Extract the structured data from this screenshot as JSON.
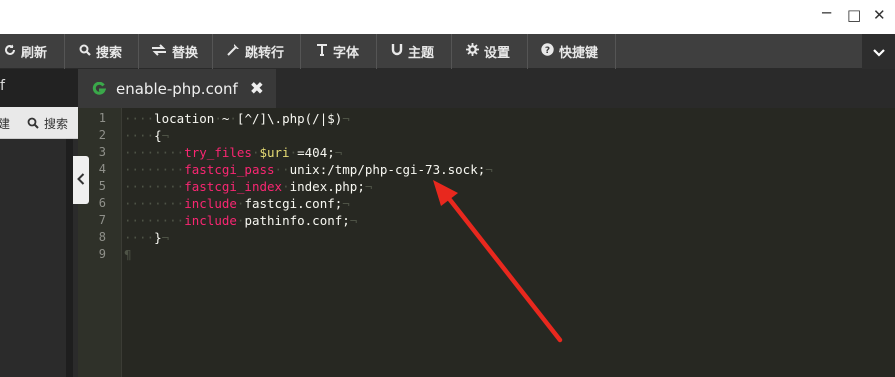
{
  "window": {
    "minimize_glyph": "─",
    "maximize_glyph": "□",
    "close_glyph": "✕"
  },
  "toolbar": {
    "items": [
      {
        "label": "刷新",
        "icon": "refresh-icon"
      },
      {
        "label": "搜索",
        "icon": "search-icon"
      },
      {
        "label": "替换",
        "icon": "replace-icon"
      },
      {
        "label": "跳转行",
        "icon": "goto-line-icon"
      },
      {
        "label": "字体",
        "icon": "font-icon"
      },
      {
        "label": "主题",
        "icon": "theme-icon"
      },
      {
        "label": "设置",
        "icon": "gear-icon"
      },
      {
        "label": "快捷键",
        "icon": "help-icon"
      }
    ],
    "more_icon": "chevron-down-icon"
  },
  "left_panel": {
    "header_fragment": "f",
    "bar_left_fragment": "建",
    "search_label": "搜索"
  },
  "tab": {
    "name": "enable-php.conf",
    "close_glyph": "✖",
    "icon": "file-type-icon"
  },
  "editor": {
    "line_numbers": [
      "1",
      "2",
      "3",
      "4",
      "5",
      "6",
      "7",
      "8",
      "9"
    ],
    "lines": [
      [
        {
          "t": "····",
          "c": "ws"
        },
        {
          "t": "location",
          "c": "op"
        },
        {
          "t": "·",
          "c": "ws"
        },
        {
          "t": "~",
          "c": "op"
        },
        {
          "t": "·",
          "c": "ws"
        },
        {
          "t": "[^/]\\.php(/|$)",
          "c": "op"
        },
        {
          "t": "¬",
          "c": "eol"
        }
      ],
      [
        {
          "t": "····",
          "c": "ws"
        },
        {
          "t": "{",
          "c": "op"
        },
        {
          "t": "¬",
          "c": "eol"
        }
      ],
      [
        {
          "t": "········",
          "c": "ws"
        },
        {
          "t": "try_files",
          "c": "kw"
        },
        {
          "t": "·",
          "c": "ws"
        },
        {
          "t": "$uri",
          "c": "var"
        },
        {
          "t": "·",
          "c": "ws"
        },
        {
          "t": "=404;",
          "c": "op"
        },
        {
          "t": "¬",
          "c": "eol"
        }
      ],
      [
        {
          "t": "········",
          "c": "ws"
        },
        {
          "t": "fastcgi_pass",
          "c": "kw"
        },
        {
          "t": "··",
          "c": "ws"
        },
        {
          "t": "unix:/tmp/php-cgi-73.sock;",
          "c": "op"
        },
        {
          "t": "¬",
          "c": "eol"
        }
      ],
      [
        {
          "t": "········",
          "c": "ws"
        },
        {
          "t": "fastcgi_index",
          "c": "kw"
        },
        {
          "t": "·",
          "c": "ws"
        },
        {
          "t": "index.php;",
          "c": "op"
        },
        {
          "t": "¬",
          "c": "eol"
        }
      ],
      [
        {
          "t": "········",
          "c": "ws"
        },
        {
          "t": "include",
          "c": "kw"
        },
        {
          "t": "·",
          "c": "ws"
        },
        {
          "t": "fastcgi.conf;",
          "c": "op"
        },
        {
          "t": "¬",
          "c": "eol"
        }
      ],
      [
        {
          "t": "········",
          "c": "ws"
        },
        {
          "t": "include",
          "c": "kw"
        },
        {
          "t": "·",
          "c": "ws"
        },
        {
          "t": "pathinfo.conf;",
          "c": "op"
        },
        {
          "t": "¬",
          "c": "eol"
        }
      ],
      [
        {
          "t": "····",
          "c": "ws"
        },
        {
          "t": "}",
          "c": "op"
        },
        {
          "t": "¬",
          "c": "eol"
        }
      ],
      [
        {
          "t": "¶",
          "c": "eol"
        }
      ]
    ]
  },
  "annotation": {
    "arrow_color": "#e8281e"
  }
}
